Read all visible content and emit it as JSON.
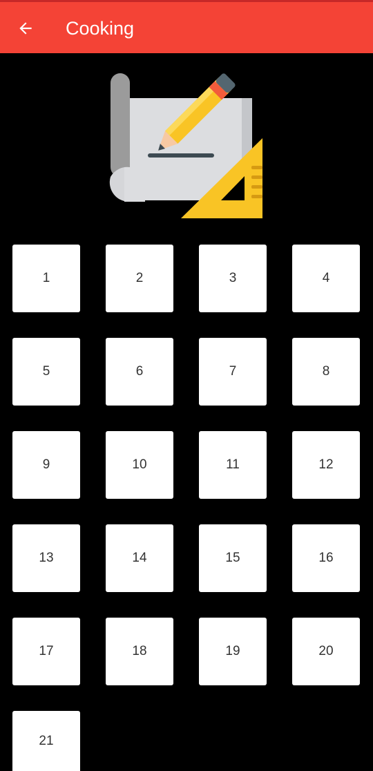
{
  "header": {
    "title": "Cooking",
    "back_icon": "arrow-left-icon",
    "background_color": "#f44336"
  },
  "hero": {
    "icon": "blueprint-pencil-ruler-icon"
  },
  "levels": [
    "1",
    "2",
    "3",
    "4",
    "5",
    "6",
    "7",
    "8",
    "9",
    "10",
    "11",
    "12",
    "13",
    "14",
    "15",
    "16",
    "17",
    "18",
    "19",
    "20",
    "21"
  ]
}
